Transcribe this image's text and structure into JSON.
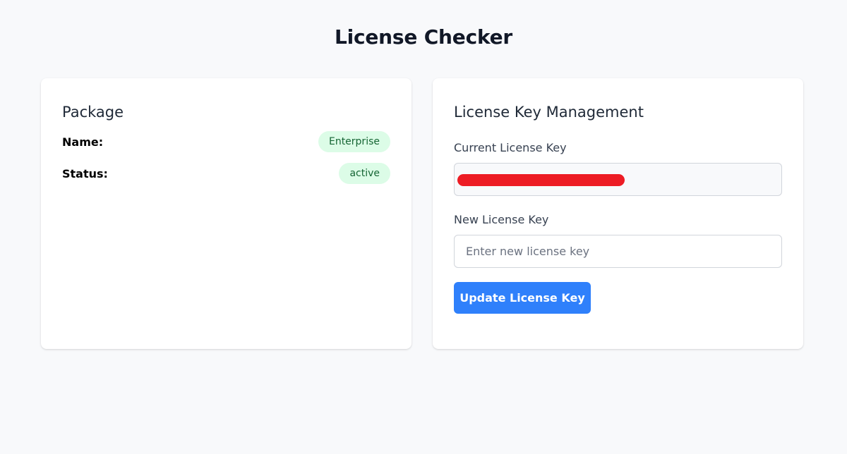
{
  "header": {
    "title": "License Checker"
  },
  "package_card": {
    "heading": "Package",
    "name_label": "Name:",
    "name_value": "Enterprise",
    "status_label": "Status:",
    "status_value": "active",
    "badge_bg": "#dcfce7",
    "badge_text_color": "#166534"
  },
  "license_card": {
    "heading": "License Key Management",
    "current_label": "Current License Key",
    "current_value_redacted": true,
    "redaction_color": "#ed1c24",
    "new_label": "New License Key",
    "new_value": "",
    "new_placeholder": "Enter new license key",
    "update_button_label": "Update License Key",
    "button_color": "#2f80fb"
  }
}
